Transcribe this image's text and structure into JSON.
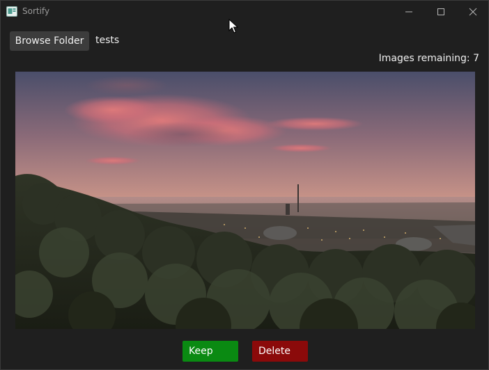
{
  "window": {
    "title": "Sortify",
    "app_icon": "image-icon",
    "controls": [
      "minimize-icon",
      "maximize-icon",
      "close-icon"
    ]
  },
  "toolbar": {
    "browse_label": "Browse Folder",
    "folder_name": "tests"
  },
  "status": {
    "remaining_text": "Images remaining: 7"
  },
  "preview": {
    "description_icon": "landscape-photo"
  },
  "actions": {
    "keep_label": "Keep",
    "delete_label": "Delete"
  },
  "colors": {
    "background": "#1f1f1f",
    "browse_button": "#3c3c3c",
    "keep_button": "#0a8a12",
    "delete_button": "#8b0a0a",
    "text": "#f0f0f0"
  }
}
